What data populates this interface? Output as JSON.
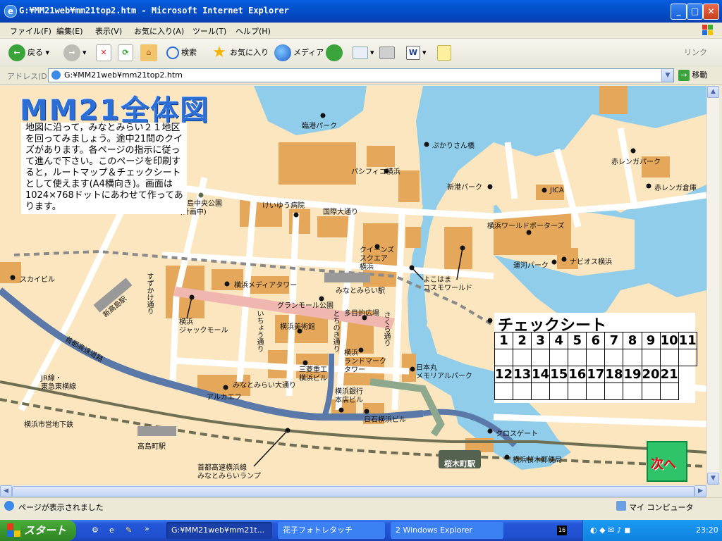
{
  "window": {
    "title": "G:¥MM21web¥mm21top2.htm - Microsoft Internet Explorer"
  },
  "menu": [
    "ファイル(F)",
    "編集(E)",
    "表示(V)",
    "お気に入り(A)",
    "ツール(T)",
    "ヘルプ(H)"
  ],
  "toolbar": {
    "back": "戻る",
    "search": "検索",
    "favorites": "お気に入り",
    "media": "メディア",
    "links": "リンク"
  },
  "address": {
    "label": "アドレス(D)",
    "url": "G:¥MM21web¥mm21top2.htm",
    "go": "移動"
  },
  "page": {
    "title": "MM21全体図",
    "intro": "地図に沿って，みなとみらい２１地区を回ってみましょう。途中21問のクイズがあります。各ページの指示に従って進んで下さい。このページを印刷すると，ルートマップ＆チェックシートとして使えます(A4横向き)。画面は1024×768ドットにあわせて作ってあります。",
    "check_title": "チェックシート",
    "check_row1": [
      "1",
      "2",
      "3",
      "4",
      "5",
      "6",
      "7",
      "8",
      "9",
      "10",
      "11"
    ],
    "check_row2": [
      "12",
      "13",
      "14",
      "15",
      "16",
      "17",
      "18",
      "19",
      "20",
      "21",
      ""
    ],
    "next": "次へ"
  },
  "map_labels": {
    "l1": "臨港パーク",
    "l2": "ぷかりさん橋",
    "l3": "パシフィコ横浜",
    "l4": "赤レンガパーク",
    "l5": "新港パーク",
    "l6": "JICA",
    "l7": "赤レンガ倉庫",
    "l8": "けいゆう病院",
    "l9": "国際大通り",
    "l10": "高島中央公園\n(計画中)",
    "l11": "横浜ワールドポーターズ",
    "l12": "クイーンズ\nスクエア\n横浜",
    "l13": "スカイビル",
    "l14": "横浜メディアタワー",
    "l15": "みなとみらい駅",
    "l16": "よこはま\nコスモワールド",
    "l17": "運河パーク",
    "l18": "ナビオス横浜",
    "l19": "グランモール公園",
    "l20": "多目的広場",
    "l21": "横浜美術館",
    "l22": "横浜\nジャックモール",
    "l23": "横浜\nランドマーク\nタワー",
    "l24": "三菱重工\n横浜ビル",
    "l25": "日本丸\nメモリアルパーク",
    "l26": "みなとみらい大通り",
    "l27": "アルカエフ",
    "l28": "横浜銀行\n本店ビル",
    "l29": "日石横浜ビル",
    "l30": "JR線・\n東急東横線",
    "l31": "横浜市営地下鉄",
    "l32": "高島町駅",
    "l33": "クロスゲート",
    "l34": "桜木町駅",
    "l35": "横浜桜木郵便局",
    "l36": "首都高速横浜線\nみなとみらいランプ",
    "l37": "すずかけ通り",
    "l38": "いちょう通り",
    "l39": "とちのき通り",
    "l40": "さくら通り",
    "l41": "首都高速道路",
    "l42": "新高島駅"
  },
  "status": {
    "text": "ページが表示されました",
    "zone": "マイ コンピュータ"
  },
  "taskbar": {
    "start": "スタート",
    "t1": "G:¥MM21web¥mm21t...",
    "t2": "花子フォトレタッチ",
    "t3": "2 Windows Explorer",
    "clock": "23:20"
  },
  "colors": {
    "land": "#fbe6bf",
    "water": "#8fcdeb",
    "building": "#e5a85a",
    "road": "#ffffff",
    "rail": "#5a6e8c"
  }
}
